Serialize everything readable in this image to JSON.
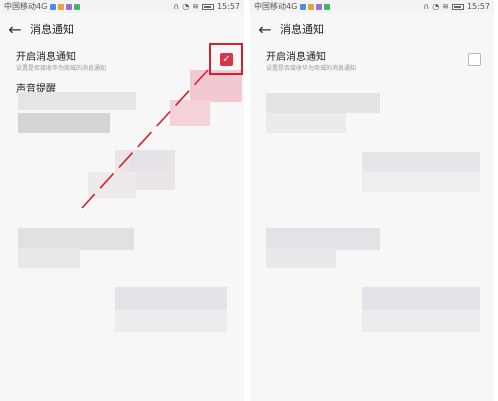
{
  "status": {
    "carrier": "中国移动4G",
    "time": "15:57"
  },
  "app": {
    "title": "消息通知"
  },
  "settings": {
    "notify_title": "开启消息通知",
    "notify_desc": "设置是否接收华为商城的消息通知",
    "sound_title": "声音提醒"
  },
  "before": {
    "notify_enabled": true
  },
  "after": {
    "notify_enabled": false
  },
  "colors": {
    "accent": "#d9344a",
    "highlight": "#d4212f",
    "text": "#222222",
    "subtext": "#999999",
    "background": "#f7f7f7"
  }
}
